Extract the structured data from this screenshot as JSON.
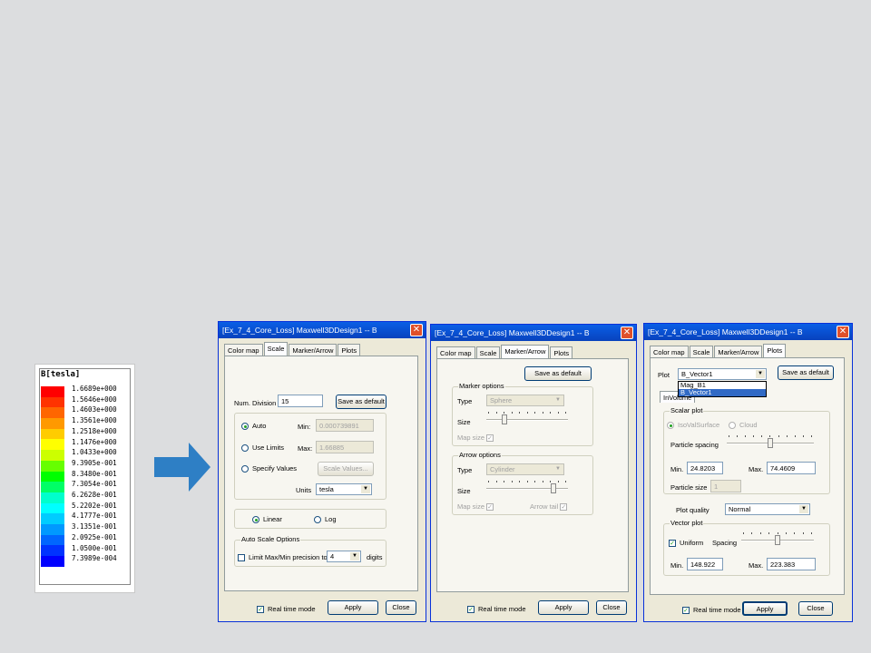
{
  "legend": {
    "title": "B[tesla]",
    "values": [
      "1.6689e+000",
      "1.5646e+000",
      "1.4603e+000",
      "1.3561e+000",
      "1.2518e+000",
      "1.1476e+000",
      "1.0433e+000",
      "9.3905e-001",
      "8.3480e-001",
      "7.3054e-001",
      "6.2628e-001",
      "5.2202e-001",
      "4.1777e-001",
      "3.1351e-001",
      "2.0925e-001",
      "1.0500e-001",
      "7.3989e-004"
    ],
    "colors": [
      "#ff0000",
      "#ff3300",
      "#ff6600",
      "#ff9900",
      "#ffcc00",
      "#ffff00",
      "#ccff00",
      "#66ff00",
      "#00ff00",
      "#00ff66",
      "#00ffcc",
      "#00ffff",
      "#00ccff",
      "#0099ff",
      "#0066ff",
      "#0033ff",
      "#0000ff"
    ]
  },
  "arrow": {
    "color": "#2e7fc5",
    "icon": "right-arrow"
  },
  "win1": {
    "title": "[Ex_7_4_Core_Loss] Maxwell3DDesign1 -- B",
    "tabs": [
      "Color map",
      "Scale",
      "Marker/Arrow",
      "Plots"
    ],
    "active_tab": "Scale",
    "num_division_label": "Num. Division",
    "num_division_value": "15",
    "save_default": "Save as default",
    "auto_label": "Auto",
    "use_limits_label": "Use Limits",
    "specify_label": "Specify Values",
    "min_label": "Min:",
    "min_value": "0.000739891",
    "max_label": "Max:",
    "max_value": "1.66885",
    "scale_values": "Scale Values...",
    "units_label": "Units",
    "units_value": "tesla",
    "linear_label": "Linear",
    "log_label": "Log",
    "auto_scale_group": "Auto Scale Options",
    "limit_label": "Limit Max/Min precision to",
    "precision_value": "4",
    "digits_label": "digits",
    "realtime_label": "Real time mode",
    "apply": "Apply",
    "close": "Close"
  },
  "win2": {
    "title": "[Ex_7_4_Core_Loss] Maxwell3DDesign1 -- B",
    "tabs": [
      "Color map",
      "Scale",
      "Marker/Arrow",
      "Plots"
    ],
    "active_tab": "Marker/Arrow",
    "save_default": "Save as default",
    "marker_group": "Marker options",
    "type_label": "Type",
    "marker_type": "Sphere",
    "size_label": "Size",
    "map_size_label": "Map size",
    "arrow_group": "Arrow options",
    "arrow_type": "Cylinder",
    "arrow_tail_label": "Arrow tail",
    "marker_size_level": 0.2,
    "arrow_size_level": 0.85,
    "realtime_label": "Real time mode",
    "apply": "Apply",
    "close": "Close"
  },
  "win3": {
    "title": "[Ex_7_4_Core_Loss] Maxwell3DDesign1 -- B",
    "tabs": [
      "Color map",
      "Scale",
      "Marker/Arrow",
      "Plots"
    ],
    "active_tab": "Plots",
    "plot_label": "Plot",
    "plot_value": "B_Vector1",
    "plot_options": [
      "Mag_B1",
      "B_Vector1"
    ],
    "save_default": "Save as default",
    "sub_tab": "InVolume",
    "scalar_group": "Scalar plot",
    "isoval_label": "IsoValSurface",
    "cloud_label": "Cloud",
    "particle_spacing_label": "Particle spacing",
    "particle_spacing_level": 0.5,
    "min_label": "Min.",
    "min_value": "24.8203",
    "max_label": "Max.",
    "max_value": "74.4609",
    "particle_size_label": "Particle size",
    "particle_size_value": "1",
    "plot_quality_label": "Plot quality",
    "plot_quality_value": "Normal",
    "vector_group": "Vector plot",
    "uniform_label": "Uniform",
    "spacing_label": "Spacing",
    "spacing_level": 0.5,
    "vmin_value": "148.922",
    "vmax_value": "223.383",
    "realtime_label": "Real time mode",
    "apply": "Apply",
    "close": "Close"
  }
}
